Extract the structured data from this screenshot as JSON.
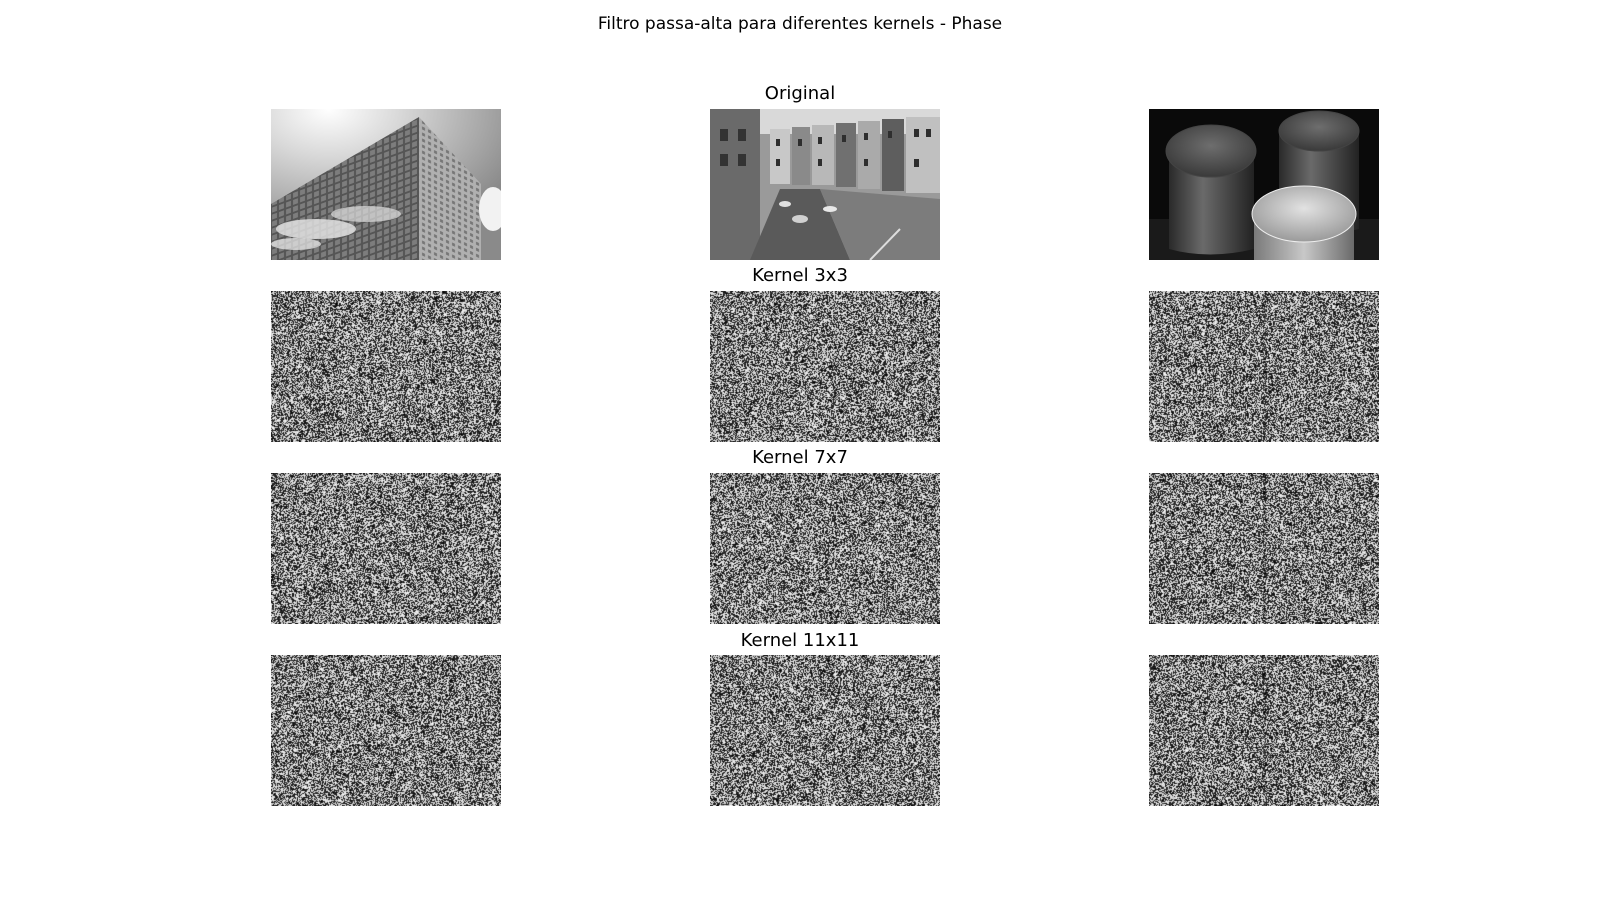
{
  "figure": {
    "suptitle": "Filtro passa-alta para diferentes kernels - Phase"
  },
  "chart_data": {
    "type": "image-grid",
    "title": "Filtro passa-alta para diferentes kernels - Phase",
    "rows": [
      {
        "title": "Original",
        "images": [
          "original-building",
          "original-canal-street",
          "original-stools"
        ]
      },
      {
        "title": "Kernel 3x3",
        "images": [
          "phase-noise-1",
          "phase-noise-2",
          "phase-noise-3"
        ]
      },
      {
        "title": "Kernel 7x7",
        "images": [
          "phase-noise-1",
          "phase-noise-2",
          "phase-noise-3"
        ]
      },
      {
        "title": "Kernel 11x11",
        "images": [
          "phase-noise-1",
          "phase-noise-2",
          "phase-noise-3"
        ]
      }
    ],
    "columns": 3
  }
}
